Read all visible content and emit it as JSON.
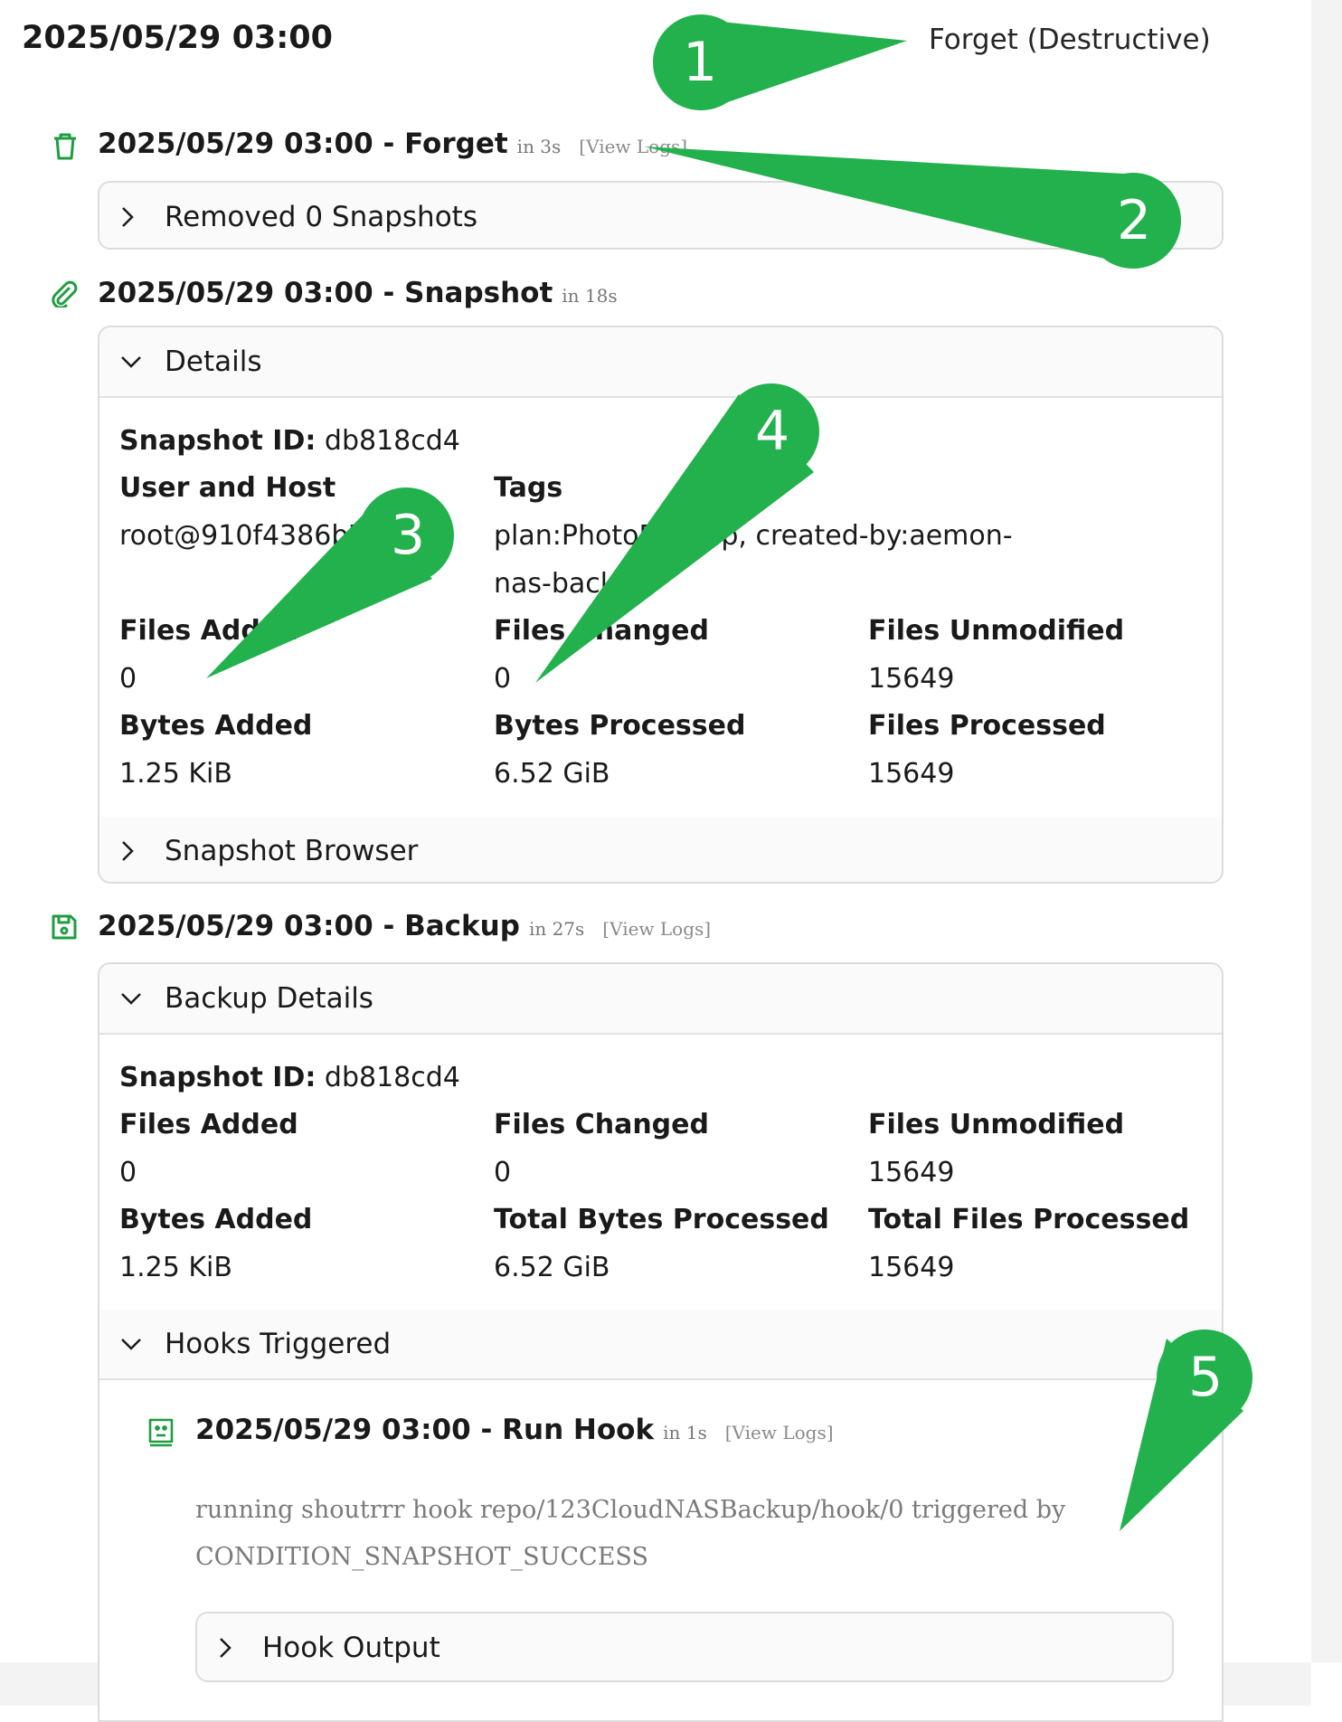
{
  "header": {
    "title": "2025/05/29 03:00",
    "right_label": "Forget (Destructive)"
  },
  "ops": {
    "forget": {
      "title": "2025/05/29 03:00 - Forget",
      "duration": "in 3s",
      "view_logs": "[View Logs]",
      "icon": "trash-icon",
      "panel": {
        "label": "Removed 0 Snapshots",
        "expanded": false
      }
    },
    "snapshot": {
      "title": "2025/05/29 03:00 - Snapshot",
      "duration": "in 18s",
      "icon": "paperclip-icon",
      "details_label": "Details",
      "snapshot_id_label": "Snapshot ID:",
      "snapshot_id_value": "db818cd4",
      "user_host_label": "User and Host",
      "user_host_value": "root@910f4386b77",
      "tags_label": "Tags",
      "tags_line1": "plan:PhotoBackup, created-by:aemon-",
      "tags_line2": "nas-backup",
      "stats": [
        {
          "label": "Files Added",
          "value": "0"
        },
        {
          "label": "Files Changed",
          "value": "0"
        },
        {
          "label": "Files Unmodified",
          "value": "15649"
        },
        {
          "label": "Bytes Added",
          "value": "1.25 KiB"
        },
        {
          "label": "Bytes Processed",
          "value": "6.52 GiB"
        },
        {
          "label": "Files Processed",
          "value": "15649"
        }
      ],
      "browser_label": "Snapshot Browser"
    },
    "backup": {
      "title": "2025/05/29 03:00 - Backup",
      "duration": "in 27s",
      "view_logs": "[View Logs]",
      "icon": "floppy-disk-icon",
      "details_label": "Backup Details",
      "snapshot_id_label": "Snapshot ID:",
      "snapshot_id_value": "db818cd4",
      "stats": [
        {
          "label": "Files Added",
          "value": "0"
        },
        {
          "label": "Files Changed",
          "value": "0"
        },
        {
          "label": "Files Unmodified",
          "value": "15649"
        },
        {
          "label": "Bytes Added",
          "value": "1.25 KiB"
        },
        {
          "label": "Total Bytes Processed",
          "value": "6.52 GiB"
        },
        {
          "label": "Total Files Processed",
          "value": "15649"
        }
      ],
      "hooks_label": "Hooks Triggered",
      "hook": {
        "title": "2025/05/29 03:00 - Run Hook",
        "duration": "in 1s",
        "view_logs": "[View Logs]",
        "icon": "robot-icon",
        "message_line1": "running shoutrrr hook repo/123CloudNASBackup/hook/0 triggered by",
        "message_line2": "CONDITION_SNAPSHOT_SUCCESS",
        "output_label": "Hook Output"
      }
    }
  },
  "callouts": [
    "1",
    "2",
    "3",
    "4",
    "5"
  ],
  "colors": {
    "accent": "#1f9d41",
    "callout": "#22b14c"
  }
}
